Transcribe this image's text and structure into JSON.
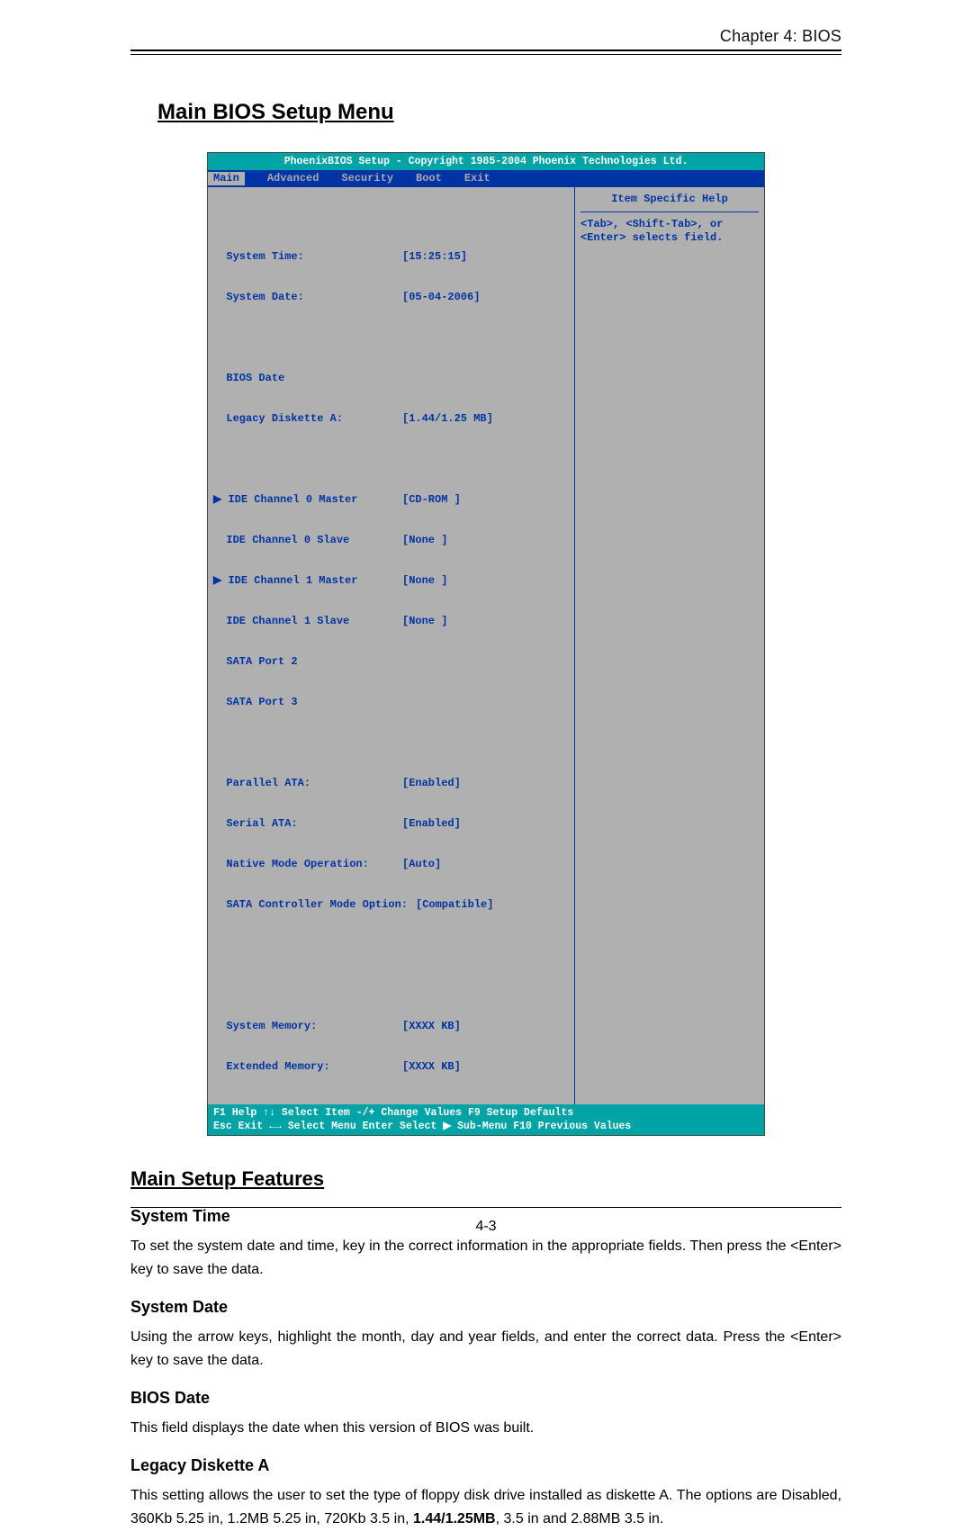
{
  "header": {
    "chapter": "Chapter 4: BIOS"
  },
  "title": "Main BIOS Setup Menu",
  "bios": {
    "banner": "PhoenixBIOS Setup - Copyright 1985-2004 Phoenix Technologies Ltd.",
    "tabs": [
      "Main",
      "Advanced",
      "Security",
      "Boot",
      "Exit"
    ],
    "fields": {
      "system_time_label": "System Time:",
      "system_time_value": "[15:25:15]",
      "system_date_label": "System Date:",
      "system_date_value": "[05-04-2006]",
      "bios_date_label": "BIOS Date",
      "legacy_a_label": "Legacy Diskette A:",
      "legacy_a_value": "[1.44/1.25 MB]",
      "ide0m_label": "IDE Channel 0 Master",
      "ide0m_value": "[CD-ROM ]",
      "ide0s_label": "IDE Channel 0 Slave",
      "ide0s_value": "[None ]",
      "ide1m_label": "IDE Channel 1 Master",
      "ide1m_value": "[None ]",
      "ide1s_label": "IDE Channel 1 Slave",
      "ide1s_value": "[None ]",
      "sata2_label": "SATA Port 2",
      "sata3_label": "SATA Port 3",
      "pata_label": "Parallel ATA:",
      "pata_value": "[Enabled]",
      "sata_label": "Serial ATA:",
      "sata_value": "[Enabled]",
      "native_label": "Native Mode Operation:",
      "native_value": "[Auto]",
      "sctrl_label": "SATA Controller Mode Option:",
      "sctrl_value": "[Compatible]",
      "sysmem_label": "System Memory:",
      "sysmem_value": "[XXXX KB]",
      "extmem_label": "Extended Memory:",
      "extmem_value": "[XXXX KB]"
    },
    "help": {
      "title": "Item Specific Help",
      "line1": "<Tab>, <Shift-Tab>, or",
      "line2": "<Enter> selects field."
    },
    "cmd": {
      "row1": "F1  Help  ↑↓ Select Item  -/+   Change Values      F9   Setup Defaults",
      "row2": "Esc Exit  ←→ Select Menu  Enter Select ▶ Sub-Menu  F10  Previous Values"
    }
  },
  "section_title": "Main Setup Features",
  "sections": {
    "system_time": {
      "head": "System Time",
      "body": "To set the system date and time, key in the correct information in the appropriate fields.  Then press the <Enter> key to save the data."
    },
    "system_date": {
      "head": "System Date",
      "body": "Using the arrow keys, highlight the month, day and year fields, and enter the correct data.  Press the <Enter> key to save the data."
    },
    "bios_date": {
      "head": "BIOS Date",
      "body": "This field displays the date when this version of BIOS was built."
    },
    "legacy_a": {
      "head": "Legacy Diskette A",
      "body_pre": "This setting allows the user to set the type of floppy disk drive installed as diskette A. The options are Disabled, 360Kb 5.25 in, 1.2MB 5.25 in, 720Kb 3.5 in, ",
      "body_bold": "1.44/1.25MB",
      "body_post": ", 3.5 in and 2.88MB 3.5 in."
    }
  },
  "page_number": "4-3"
}
